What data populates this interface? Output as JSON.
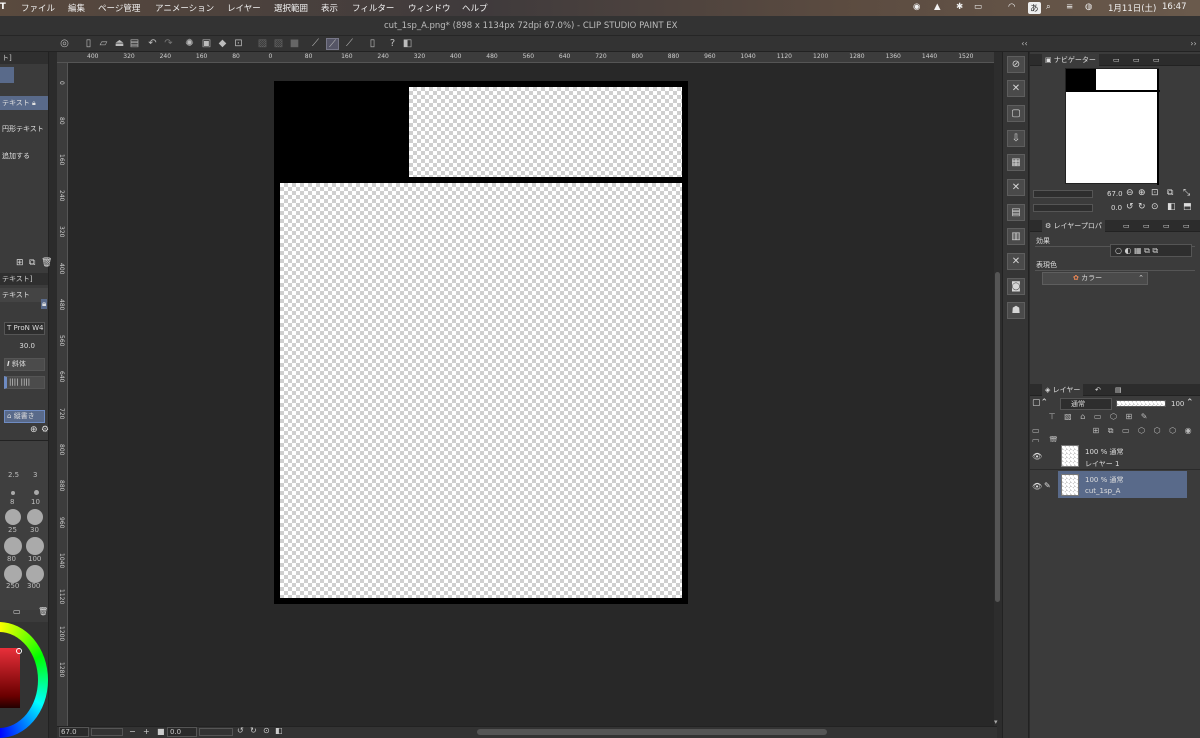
{
  "menubar": {
    "apple": "",
    "items": [
      "T",
      "ファイル",
      "編集",
      "ページ管理",
      "アニメーション",
      "レイヤー",
      "選択範囲",
      "表示",
      "フィルター",
      "ウィンドウ",
      "ヘルプ"
    ],
    "date": "1月11日(土)",
    "time": "16:47",
    "input_method": "あ"
  },
  "window": {
    "title": "cut_1sp_A.png* (898 x 1134px 72dpi 67.0%)  - CLIP STUDIO PAINT EX"
  },
  "left_panel": {
    "header1": "ト]",
    "tool_text": "テキスト",
    "tool_circle_text": "円形テキスト",
    "tool_add": "追加する",
    "header2": "テキスト]",
    "font_value": "T ProN W4",
    "size_value": "30.0",
    "italic_label": "斜体",
    "vertical_label": "縦書き",
    "brush_sizes": [
      "2.5",
      "3",
      "8",
      "10",
      "25",
      "30",
      "80",
      "100",
      "250",
      "300"
    ]
  },
  "ruler_top": [
    "400",
    "320",
    "240",
    "160",
    "80",
    "0",
    "80",
    "160",
    "240",
    "320",
    "400",
    "480",
    "560",
    "640",
    "720",
    "800",
    "880",
    "960",
    "1040",
    "1120",
    "1200",
    "1280",
    "1360",
    "1440",
    "1520"
  ],
  "ruler_left": [
    "0",
    "80",
    "160",
    "240",
    "320",
    "400",
    "480",
    "560",
    "640",
    "720",
    "800",
    "880",
    "960",
    "1040",
    "1120",
    "1200",
    "1280"
  ],
  "statusbar": {
    "zoom": "67.0",
    "angle": "0.0"
  },
  "navigator": {
    "tab": "ナビゲーター",
    "zoom_value": "67.0",
    "rotate_value": "0.0"
  },
  "layer_property": {
    "tab": "レイヤープロパ",
    "effect_label": "効果",
    "color_label": "表現色",
    "color_value": "カラー"
  },
  "layers": {
    "tab": "レイヤー",
    "blend_mode": "通常",
    "opacity": "100",
    "items": [
      {
        "mode": "100 % 通常",
        "name": "レイヤー 1",
        "selected": false
      },
      {
        "mode": "100 % 通常",
        "name": "cut_1sp_A",
        "selected": true
      }
    ]
  },
  "colors": {
    "accent": "#596a8a",
    "canvas_bg": "#282828",
    "panel_bg": "#3b3b3b"
  }
}
